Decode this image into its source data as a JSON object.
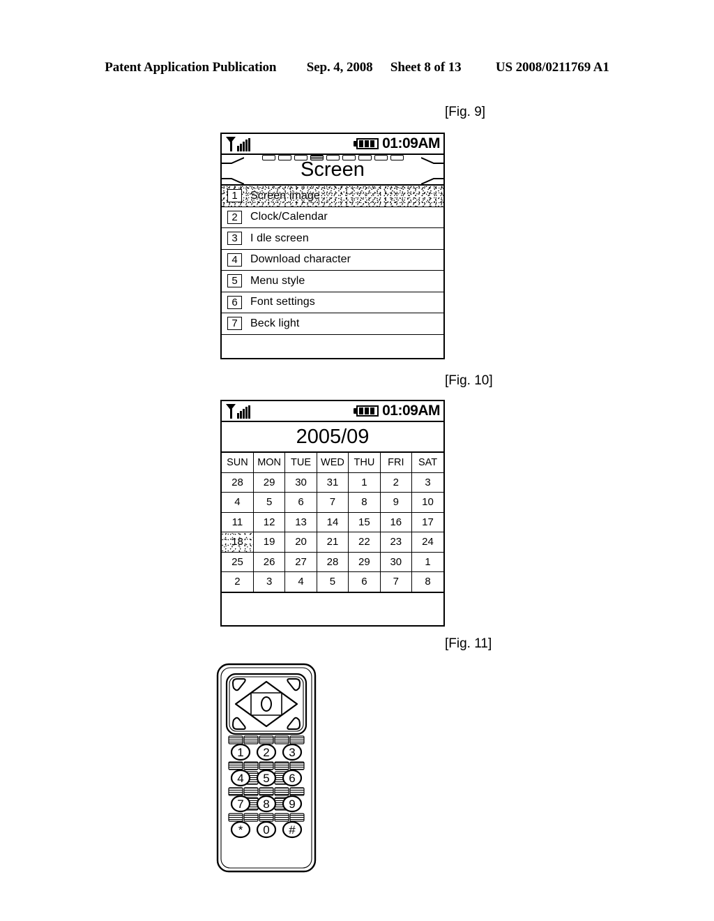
{
  "header": {
    "publication": "Patent Application Publication",
    "date": "Sep. 4, 2008",
    "sheet": "Sheet 8 of 13",
    "patent_number": "US 2008/0211769 A1"
  },
  "figures": {
    "fig9_caption": "[Fig. 9]",
    "fig10_caption": "[Fig. 10]",
    "fig11_caption": "[Fig. 11]"
  },
  "fig9": {
    "status": {
      "signal_icon": "antenna-signal-icon",
      "battery_icon": "battery-icon",
      "time": "01:09AM"
    },
    "tabs": [
      {
        "active": false
      },
      {
        "active": false
      },
      {
        "active": false
      },
      {
        "active": true
      },
      {
        "active": false
      },
      {
        "active": false
      },
      {
        "active": false
      },
      {
        "active": false
      },
      {
        "active": false
      }
    ],
    "title": "Screen",
    "menu_items": [
      {
        "num": "1",
        "label": "Screen image",
        "selected": true
      },
      {
        "num": "2",
        "label": "Clock/Calendar",
        "selected": false
      },
      {
        "num": "3",
        "label": "I dle screen",
        "selected": false
      },
      {
        "num": "4",
        "label": "Download character",
        "selected": false
      },
      {
        "num": "5",
        "label": "Menu style",
        "selected": false
      },
      {
        "num": "6",
        "label": "Font settings",
        "selected": false
      },
      {
        "num": "7",
        "label": "Beck light",
        "selected": false
      }
    ]
  },
  "fig10": {
    "status": {
      "signal_icon": "antenna-signal-icon",
      "battery_icon": "battery-icon",
      "time": "01:09AM"
    },
    "title": "2005/09",
    "weekdays": [
      "SUN",
      "MON",
      "TUE",
      "WED",
      "THU",
      "FRI",
      "SAT"
    ],
    "weeks": [
      [
        "28",
        "29",
        "30",
        "31",
        "1",
        "2",
        "3"
      ],
      [
        "4",
        "5",
        "6",
        "7",
        "8",
        "9",
        "10"
      ],
      [
        "11",
        "12",
        "13",
        "14",
        "15",
        "16",
        "17"
      ],
      [
        "18",
        "19",
        "20",
        "21",
        "22",
        "23",
        "24"
      ],
      [
        "25",
        "26",
        "27",
        "28",
        "29",
        "30",
        "1"
      ],
      [
        "2",
        "3",
        "4",
        "5",
        "6",
        "7",
        "8"
      ]
    ],
    "selected_day": {
      "row": 3,
      "col": 0,
      "value": "18"
    }
  },
  "fig11": {
    "device": "mobile-handset",
    "navigation": {
      "type": "four-way-dpad",
      "center_key": "center-select-key",
      "corner_keys": [
        "soft-key-top-left",
        "soft-key-top-right",
        "soft-key-bottom-left",
        "soft-key-bottom-right"
      ]
    },
    "keypad_rows": [
      [
        "1",
        "2",
        "3"
      ],
      [
        "4",
        "5",
        "6"
      ],
      [
        "7",
        "8",
        "9"
      ],
      [
        "*",
        "0",
        "#"
      ]
    ]
  },
  "colors": {
    "ink": "#000000",
    "paper": "#ffffff"
  }
}
